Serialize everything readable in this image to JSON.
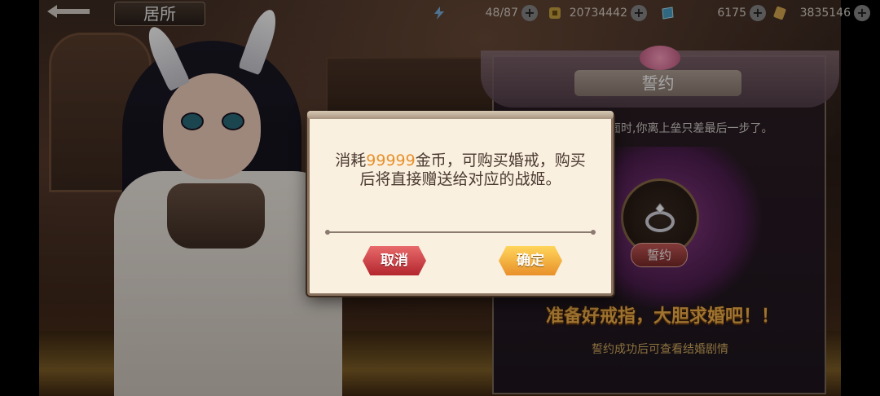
{
  "topbar": {
    "title": "居所",
    "resources": [
      {
        "icon": "lightning-icon",
        "value": "48/87"
      },
      {
        "icon": "gold-coin-icon",
        "value": "20734442"
      },
      {
        "icon": "gem-icon",
        "value": "6175"
      },
      {
        "icon": "scroll-icon",
        "value": "3835146"
      }
    ],
    "plus": "+"
  },
  "oath_panel": {
    "title": "誓约",
    "description": "面时,你离上垒只差最后一步了。",
    "button_label": "誓约",
    "slogan": "准备好戒指，大胆求婚吧！！",
    "hint": "誓约成功后可查看结婚剧情"
  },
  "modal": {
    "message_prefix": "消耗",
    "amount": "99999",
    "message_suffix": "金币，可购买婚戒，购买后将直接赠送给对应的战姬。",
    "cancel_label": "取消",
    "confirm_label": "确定"
  },
  "colors": {
    "highlight": "#e8912c",
    "cancel": "#c8303a",
    "confirm": "#f4b23c",
    "slogan": "#f4b24a"
  }
}
